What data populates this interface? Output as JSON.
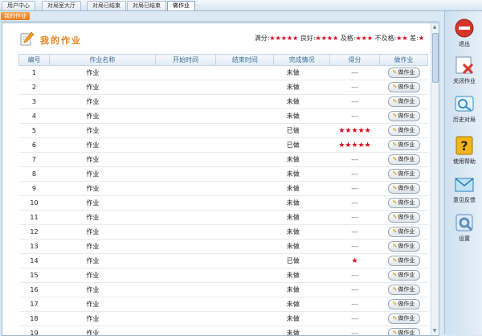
{
  "tabs": [
    {
      "label": "用户中心"
    },
    {
      "label": "对局室大厅"
    },
    {
      "label": "对局已结束"
    },
    {
      "label": "对局已结束"
    },
    {
      "label": "做作业"
    }
  ],
  "subtab": {
    "label": "我的作业"
  },
  "header": {
    "title": "我的作业",
    "legend": {
      "full_label": "满分:",
      "full_stars": "★★★★★",
      "good_label": "良好:",
      "good_stars": "★★★★",
      "pass_label": "及格:",
      "pass_stars": "★★★",
      "fail_label": "不及格:",
      "fail_stars": "★★",
      "poor_label": "差:",
      "poor_stars": "★"
    }
  },
  "table": {
    "columns": [
      "编号",
      "作业名称",
      "开始时间",
      "结束时间",
      "完成情况",
      "得分",
      "做作业"
    ],
    "rows": [
      {
        "no": "1",
        "name": "作业",
        "start": "",
        "end": "",
        "status": "未做",
        "score": "---",
        "action": "做作业"
      },
      {
        "no": "2",
        "name": "作业",
        "start": "",
        "end": "",
        "status": "未做",
        "score": "---",
        "action": "做作业"
      },
      {
        "no": "3",
        "name": "作业",
        "start": "",
        "end": "",
        "status": "未做",
        "score": "---",
        "action": "做作业"
      },
      {
        "no": "4",
        "name": "作业",
        "start": "",
        "end": "",
        "status": "未做",
        "score": "---",
        "action": "做作业"
      },
      {
        "no": "5",
        "name": "作业",
        "start": "",
        "end": "",
        "status": "已做",
        "score": "★★★★★",
        "action": "做作业"
      },
      {
        "no": "6",
        "name": "作业",
        "start": "",
        "end": "",
        "status": "已做",
        "score": "★★★★★",
        "action": "做作业"
      },
      {
        "no": "7",
        "name": "作业",
        "start": "",
        "end": "",
        "status": "未做",
        "score": "---",
        "action": "做作业"
      },
      {
        "no": "8",
        "name": "作业",
        "start": "",
        "end": "",
        "status": "未做",
        "score": "---",
        "action": "做作业"
      },
      {
        "no": "9",
        "name": "作业",
        "start": "",
        "end": "",
        "status": "未做",
        "score": "---",
        "action": "做作业"
      },
      {
        "no": "10",
        "name": "作业",
        "start": "",
        "end": "",
        "status": "未做",
        "score": "---",
        "action": "做作业"
      },
      {
        "no": "11",
        "name": "作业",
        "start": "",
        "end": "",
        "status": "未做",
        "score": "---",
        "action": "做作业"
      },
      {
        "no": "12",
        "name": "作业",
        "start": "",
        "end": "",
        "status": "未做",
        "score": "---",
        "action": "做作业"
      },
      {
        "no": "13",
        "name": "作业",
        "start": "",
        "end": "",
        "status": "未做",
        "score": "---",
        "action": "做作业"
      },
      {
        "no": "14",
        "name": "作业",
        "start": "",
        "end": "",
        "status": "已做",
        "score": "★",
        "action": "做作业"
      },
      {
        "no": "15",
        "name": "作业",
        "start": "",
        "end": "",
        "status": "未做",
        "score": "---",
        "action": "做作业"
      },
      {
        "no": "16",
        "name": "作业",
        "start": "",
        "end": "",
        "status": "未做",
        "score": "---",
        "action": "做作业"
      },
      {
        "no": "17",
        "name": "作业",
        "start": "",
        "end": "",
        "status": "未做",
        "score": "---",
        "action": "做作业"
      },
      {
        "no": "18",
        "name": "作业",
        "start": "",
        "end": "",
        "status": "未做",
        "score": "---",
        "action": "做作业"
      },
      {
        "no": "19",
        "name": "作业",
        "start": "",
        "end": "",
        "status": "未做",
        "score": "---",
        "action": "做作业"
      }
    ]
  },
  "sidebar": {
    "items": [
      {
        "label": "退出",
        "icon": "exit-icon",
        "color": "#d9342b"
      },
      {
        "label": "关闭作业",
        "icon": "close-homework-icon",
        "color": "#2f6fb5"
      },
      {
        "label": "历史对局",
        "icon": "history-games-icon",
        "color": "#2f8fd0"
      },
      {
        "label": "使用帮助",
        "icon": "help-icon",
        "color": "#f2b51b"
      },
      {
        "label": "意见反馈",
        "icon": "feedback-icon",
        "color": "#3aa0e0"
      },
      {
        "label": "设置",
        "icon": "settings-icon",
        "color": "#5b8fc4"
      }
    ]
  },
  "colors": {
    "accent": "#e8821c",
    "star": "#e0001b",
    "header_text": "#3b6d99"
  }
}
